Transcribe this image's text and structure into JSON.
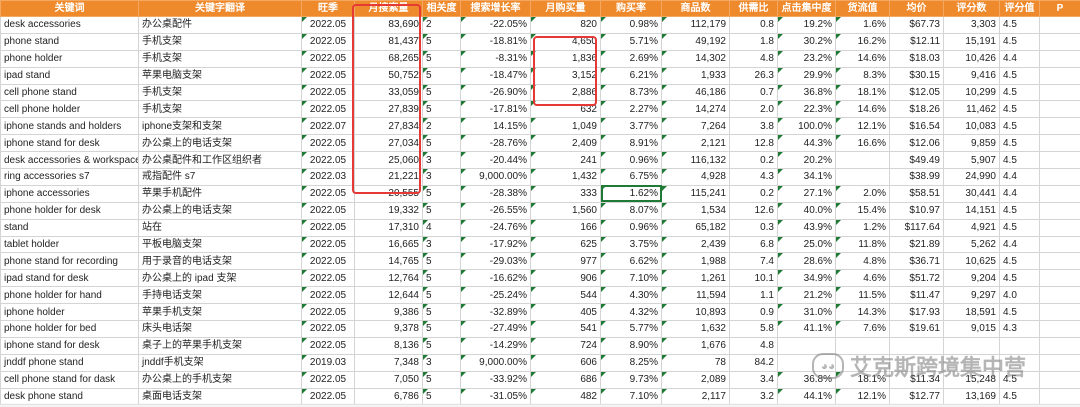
{
  "columns": [
    "关键词",
    "关键字翻译",
    "旺季",
    "月搜索量",
    "相关度",
    "搜索增长率",
    "月购买量",
    "购买率",
    "商品数",
    "供需比",
    "点击集中度",
    "货流值",
    "均价",
    "评分数",
    "评分值",
    "P"
  ],
  "rows": [
    [
      "desk accessories",
      "办公桌配件",
      "2022.05",
      "83,690",
      "2",
      "-22.05%",
      "820",
      "0.98%",
      "112,179",
      "0.8",
      "19.2%",
      "1.6%",
      "$67.73",
      "3,303",
      "4.5",
      ""
    ],
    [
      "phone stand",
      "手机支架",
      "2022.05",
      "81,437",
      "5",
      "-18.81%",
      "4,650",
      "5.71%",
      "49,192",
      "1.8",
      "30.2%",
      "16.2%",
      "$12.11",
      "15,191",
      "4.5",
      ""
    ],
    [
      "phone holder",
      "手机支架",
      "2022.05",
      "68,265",
      "5",
      "-8.31%",
      "1,836",
      "2.69%",
      "14,302",
      "4.8",
      "23.2%",
      "14.6%",
      "$18.03",
      "10,426",
      "4.4",
      ""
    ],
    [
      "ipad stand",
      "苹果电脑支架",
      "2022.05",
      "50,752",
      "5",
      "-18.47%",
      "3,152",
      "6.21%",
      "1,933",
      "26.3",
      "29.9%",
      "8.3%",
      "$30.15",
      "9,416",
      "4.5",
      ""
    ],
    [
      "cell phone stand",
      "手机支架",
      "2022.05",
      "33,059",
      "5",
      "-26.90%",
      "2,886",
      "8.73%",
      "46,186",
      "0.7",
      "36.8%",
      "18.1%",
      "$12.05",
      "10,299",
      "4.5",
      ""
    ],
    [
      "cell phone holder",
      "手机支架",
      "2022.05",
      "27,839",
      "5",
      "-17.81%",
      "632",
      "2.27%",
      "14,274",
      "2.0",
      "22.3%",
      "14.6%",
      "$18.26",
      "11,462",
      "4.5",
      ""
    ],
    [
      "iphone stands and holders",
      "iphone支架和支架",
      "2022.07",
      "27,834",
      "2",
      "14.15%",
      "1,049",
      "3.77%",
      "7,264",
      "3.8",
      "100.0%",
      "12.1%",
      "$16.54",
      "10,083",
      "4.5",
      ""
    ],
    [
      "iphone stand for desk",
      "办公桌上的电话支架",
      "2022.05",
      "27,034",
      "5",
      "-28.76%",
      "2,409",
      "8.91%",
      "2,121",
      "12.8",
      "44.3%",
      "16.6%",
      "$12.06",
      "9,859",
      "4.5",
      ""
    ],
    [
      "desk accessories & workspace organiz",
      "办公桌配件和工作区组织者",
      "2022.05",
      "25,060",
      "3",
      "-20.44%",
      "241",
      "0.96%",
      "116,132",
      "0.2",
      "20.2%",
      "",
      "$49.49",
      "5,907",
      "4.5",
      ""
    ],
    [
      "ring accessories s7",
      "戒指配件 s7",
      "2022.03",
      "21,221",
      "3",
      "9,000.00%",
      "1,432",
      "6.75%",
      "4,928",
      "4.3",
      "34.1%",
      "",
      "$38.99",
      "24,990",
      "4.4",
      ""
    ],
    [
      "iphone accessories",
      "苹果手机配件",
      "2022.05",
      "20,555",
      "5",
      "-28.38%",
      "333",
      "1.62%",
      "115,241",
      "0.2",
      "27.1%",
      "2.0%",
      "$58.51",
      "30,441",
      "4.4",
      ""
    ],
    [
      "phone holder for desk",
      "办公桌上的电话支架",
      "2022.05",
      "19,332",
      "5",
      "-26.55%",
      "1,560",
      "8.07%",
      "1,534",
      "12.6",
      "40.0%",
      "15.4%",
      "$10.97",
      "14,151",
      "4.5",
      ""
    ],
    [
      "stand",
      "站在",
      "2022.05",
      "17,310",
      "4",
      "-24.76%",
      "166",
      "0.96%",
      "65,182",
      "0.3",
      "43.9%",
      "1.2%",
      "$117.64",
      "4,921",
      "4.5",
      ""
    ],
    [
      "tablet holder",
      "平板电脑支架",
      "2022.05",
      "16,665",
      "3",
      "-17.92%",
      "625",
      "3.75%",
      "2,439",
      "6.8",
      "25.0%",
      "11.8%",
      "$21.89",
      "5,262",
      "4.4",
      ""
    ],
    [
      "phone stand for recording",
      "用于录音的电话支架",
      "2022.05",
      "14,765",
      "5",
      "-29.03%",
      "977",
      "6.62%",
      "1,988",
      "7.4",
      "28.6%",
      "4.8%",
      "$36.71",
      "10,625",
      "4.5",
      ""
    ],
    [
      "ipad stand for desk",
      "办公桌上的 ipad 支架",
      "2022.05",
      "12,764",
      "5",
      "-16.62%",
      "906",
      "7.10%",
      "1,261",
      "10.1",
      "34.9%",
      "4.6%",
      "$51.72",
      "9,204",
      "4.5",
      ""
    ],
    [
      "phone holder for hand",
      "手持电话支架",
      "2022.05",
      "12,644",
      "5",
      "-25.24%",
      "544",
      "4.30%",
      "11,594",
      "1.1",
      "21.2%",
      "11.5%",
      "$11.47",
      "9,297",
      "4.0",
      ""
    ],
    [
      "iphone holder",
      "苹果手机支架",
      "2022.05",
      "9,386",
      "5",
      "-32.89%",
      "405",
      "4.32%",
      "10,893",
      "0.9",
      "31.0%",
      "14.3%",
      "$17.93",
      "18,591",
      "4.5",
      ""
    ],
    [
      "phone holder for bed",
      "床头电话架",
      "2022.05",
      "9,378",
      "5",
      "-27.49%",
      "541",
      "5.77%",
      "1,632",
      "5.8",
      "41.1%",
      "7.6%",
      "$19.61",
      "9,015",
      "4.3",
      ""
    ],
    [
      "iphone stand for desk",
      "桌子上的苹果手机支架",
      "2022.05",
      "8,136",
      "5",
      "-14.29%",
      "724",
      "8.90%",
      "1,676",
      "4.8",
      "",
      "",
      "",
      "",
      "",
      ""
    ],
    [
      "jnddf phone stand",
      "jnddf手机支架",
      "2019.03",
      "7,348",
      "3",
      "9,000.00%",
      "606",
      "8.25%",
      "78",
      "84.2",
      "",
      "",
      "",
      "",
      "",
      ""
    ],
    [
      "cell phone stand for dask",
      "办公桌上的手机支架",
      "2022.05",
      "7,050",
      "5",
      "-33.92%",
      "686",
      "9.73%",
      "2,089",
      "3.4",
      "36.8%",
      "18.1%",
      "$11.34",
      "15,248",
      "4.5",
      ""
    ],
    [
      "desk phone stand",
      "桌面电话支架",
      "2022.05",
      "6,786",
      "5",
      "-31.05%",
      "482",
      "7.10%",
      "2,117",
      "3.2",
      "44.1%",
      "12.1%",
      "$12.77",
      "13,169",
      "4.5",
      ""
    ]
  ],
  "watermark": {
    "icon": "wechat-icon",
    "text": "艾克斯跨境集中营"
  },
  "colors": {
    "header_bg": "#ef8a2c",
    "highlight_box": "#e53935",
    "selected_cell": "#1f7a35"
  }
}
